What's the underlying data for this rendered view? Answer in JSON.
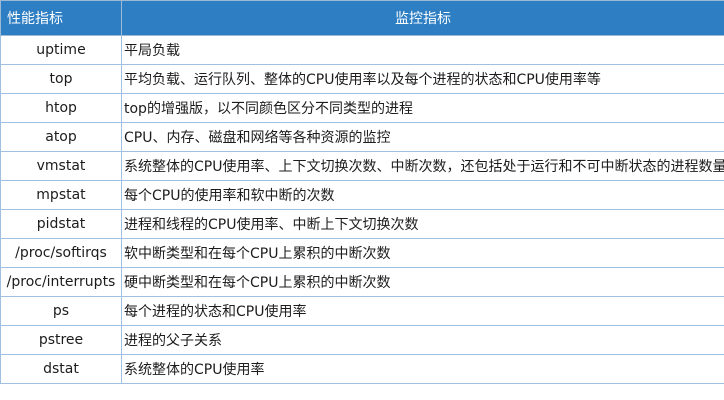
{
  "table": {
    "headers": [
      "性能指标",
      "监控指标"
    ],
    "rows": [
      {
        "tool": "uptime",
        "desc": "平局负载"
      },
      {
        "tool": "top",
        "desc": "平均负载、运行队列、整体的CPU使用率以及每个进程的状态和CPU使用率等"
      },
      {
        "tool": "htop",
        "desc": "top的增强版，以不同颜色区分不同类型的进程"
      },
      {
        "tool": "atop",
        "desc": "CPU、内存、磁盘和网络等各种资源的监控"
      },
      {
        "tool": "vmstat",
        "desc": "系统整体的CPU使用率、上下文切换次数、中断次数，还包括处于运行和不可中断状态的进程数量"
      },
      {
        "tool": "mpstat",
        "desc": "每个CPU的使用率和软中断的次数"
      },
      {
        "tool": "pidstat",
        "desc": "进程和线程的CPU使用率、中断上下文切换次数"
      },
      {
        "tool": "/proc/softirqs",
        "desc": "软中断类型和在每个CPU上累积的中断次数"
      },
      {
        "tool": "/proc/interrupts",
        "desc": "硬中断类型和在每个CPU上累积的中断次数"
      },
      {
        "tool": "ps",
        "desc": "每个进程的状态和CPU使用率"
      },
      {
        "tool": "pstree",
        "desc": "进程的父子关系"
      },
      {
        "tool": "dstat",
        "desc": "系统整体的CPU使用率"
      }
    ]
  }
}
